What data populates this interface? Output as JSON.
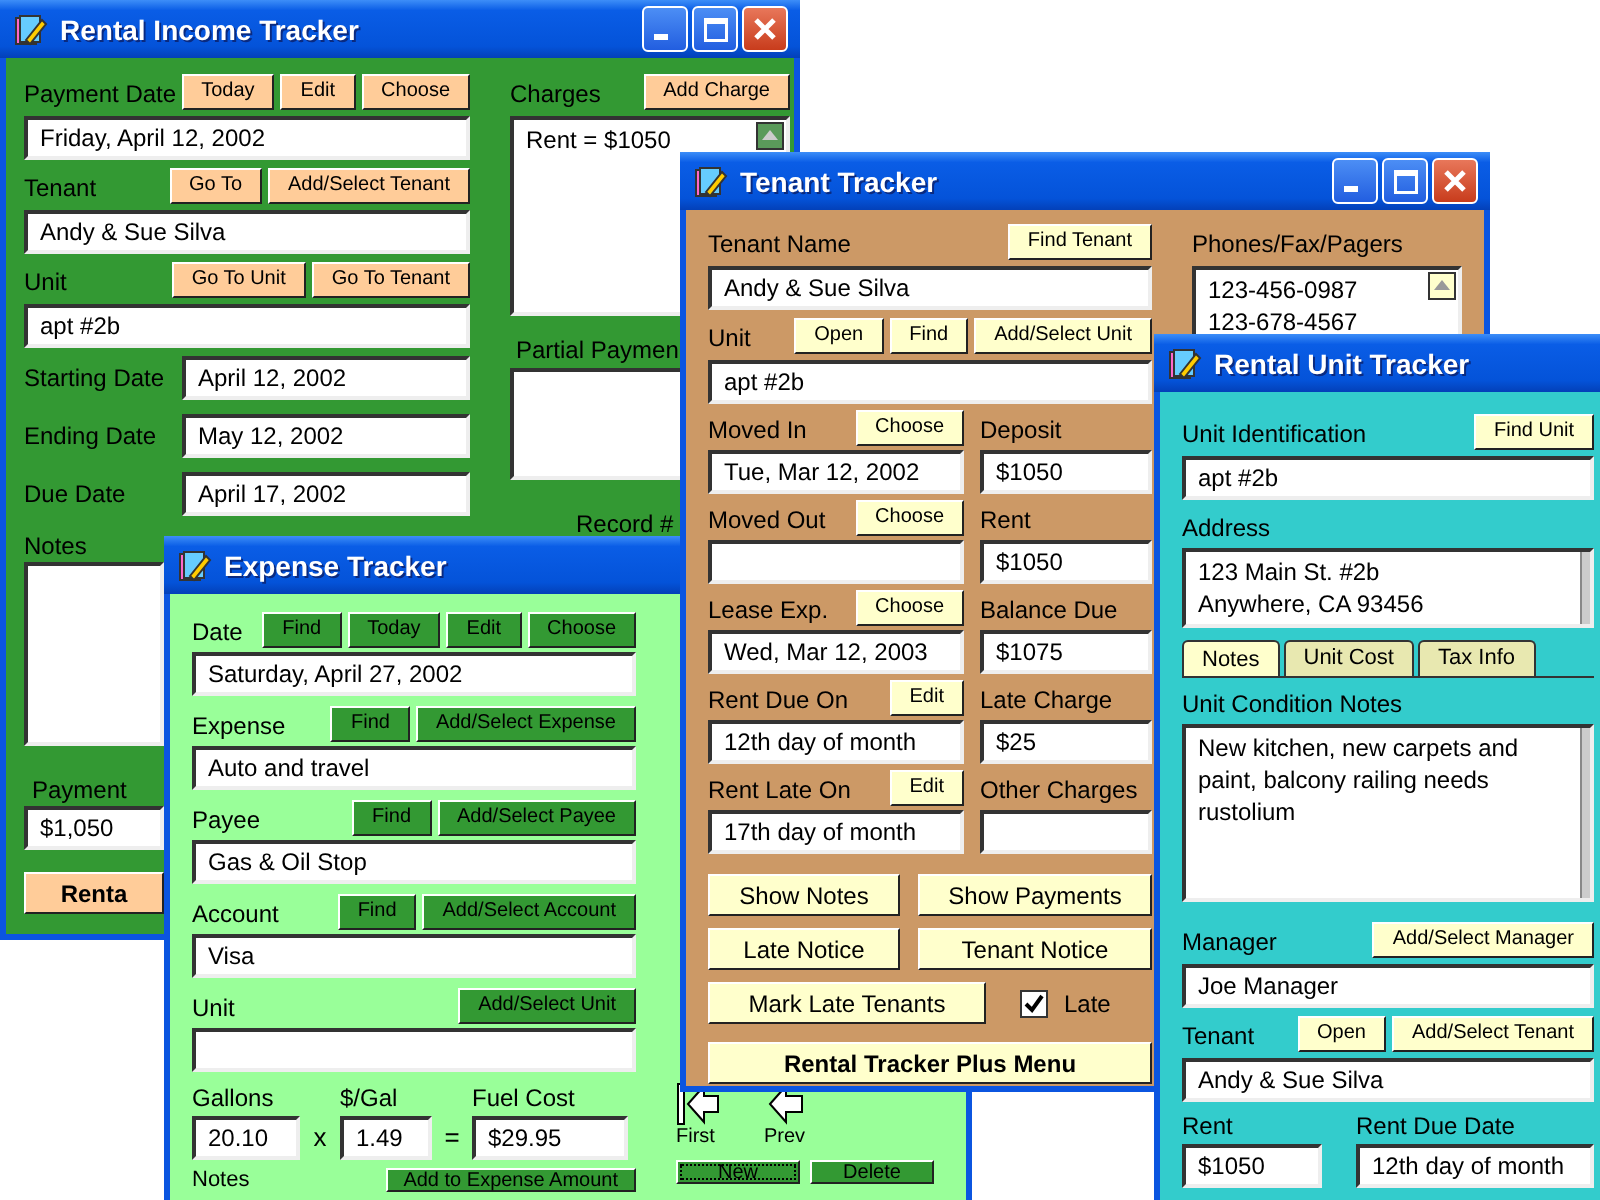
{
  "rental_income_tracker": {
    "title": "Rental Income Tracker",
    "fields": [
      {
        "label": "Payment Date",
        "buttons": [
          "Today",
          "Edit",
          "Choose"
        ],
        "value": "Friday, April 12, 2002"
      },
      {
        "label": "Tenant",
        "buttons": [
          "Go To",
          "Add/Select Tenant"
        ],
        "value": "Andy & Sue Silva"
      },
      {
        "label": "Unit",
        "buttons": [
          "Go To Unit",
          "Go To Tenant"
        ],
        "value": "apt #2b"
      }
    ],
    "dates": [
      {
        "label": "Starting Date",
        "value": "April 12, 2002"
      },
      {
        "label": "Ending Date",
        "value": "May 12, 2002"
      },
      {
        "label": "Due Date",
        "value": "April 17, 2002"
      }
    ],
    "notes": {
      "label": "Notes"
    },
    "payment": {
      "label": "Payment",
      "value": "$1,050"
    },
    "menu_button": "Renta",
    "charges": {
      "label": "Charges",
      "button": "Add Charge",
      "items": [
        "Rent = $1050"
      ]
    },
    "partial_payments": {
      "label": "Partial Paymen"
    },
    "record": {
      "label": "Record #"
    }
  },
  "expense_tracker": {
    "title": "Expense Tracker",
    "fields": [
      {
        "label": "Date",
        "buttons": [
          "Find",
          "Today",
          "Edit",
          "Choose"
        ],
        "value": "Saturday, April 27, 2002"
      },
      {
        "label": "Expense",
        "buttons": [
          "Find",
          "Add/Select Expense"
        ],
        "value": "Auto and travel"
      },
      {
        "label": "Payee",
        "buttons": [
          "Find",
          "Add/Select Payee"
        ],
        "value": "Gas & Oil Stop"
      },
      {
        "label": "Account",
        "buttons": [
          "Find",
          "Add/Select Account"
        ],
        "value": "Visa"
      },
      {
        "label": "Unit",
        "buttons": [
          "Add/Select Unit"
        ]
      }
    ],
    "fuel": {
      "gallons": {
        "label": "Gallons",
        "value": "20.10"
      },
      "times": "x",
      "price": {
        "label": "$/Gal",
        "value": "1.49"
      },
      "equals": "=",
      "cost": {
        "label": "Fuel Cost",
        "value": "$29.95"
      }
    },
    "notes": {
      "label": "Notes",
      "button": "Add to Expense Amount"
    },
    "nav": [
      {
        "kind": "first",
        "label": "First"
      },
      {
        "kind": "prev",
        "label": "Prev"
      }
    ],
    "buttons": [
      {
        "label": "New",
        "focused": true
      },
      {
        "label": "Delete",
        "focused": false
      }
    ]
  },
  "tenant_tracker": {
    "title": "Tenant Tracker",
    "fields": [
      {
        "label": "Tenant Name",
        "buttons": [
          "Find Tenant"
        ],
        "value": "Andy & Sue Silva"
      },
      {
        "label": "Unit",
        "buttons": [
          "Open",
          "Find",
          "Add/Select Unit"
        ],
        "value": "apt #2b"
      }
    ],
    "phones": {
      "label": "Phones/Fax/Pagers",
      "items": [
        "123-456-0987",
        "123-678-4567"
      ]
    },
    "rows": [
      {
        "left": {
          "label": "Moved In",
          "buttons": [
            "Choose"
          ],
          "value": "Tue, Mar 12, 2002"
        },
        "right": {
          "label": "Deposit",
          "value": "$1050"
        }
      },
      {
        "left": {
          "label": "Moved Out",
          "buttons": [
            "Choose"
          ]
        },
        "right": {
          "label": "Rent",
          "value": "$1050"
        }
      },
      {
        "left": {
          "label": "Lease Exp.",
          "buttons": [
            "Choose"
          ],
          "value": "Wed, Mar 12, 2003"
        },
        "right": {
          "label": "Balance Due",
          "value": "$1075"
        }
      },
      {
        "left": {
          "label": "Rent Due On",
          "buttons": [
            "Edit"
          ],
          "value": "12th day of month"
        },
        "right": {
          "label": "Late Charge",
          "value": "$25"
        }
      },
      {
        "left": {
          "label": "Rent Late On",
          "buttons": [
            "Edit"
          ],
          "value": "17th day of month"
        },
        "right": {
          "label": "Other Charges"
        }
      }
    ],
    "actions": [
      [
        "Show Notes",
        "Show Payments"
      ],
      [
        "Late Notice",
        "Tenant Notice"
      ]
    ],
    "mark_button": "Mark Late Tenants",
    "late": {
      "label": "Late",
      "checked": true
    },
    "menu_button": "Rental Tracker Plus Menu"
  },
  "rental_unit_tracker": {
    "title": "Rental Unit Tracker",
    "unit": {
      "label": "Unit Identification",
      "buttons": [
        "Find Unit"
      ],
      "value": "apt #2b"
    },
    "address": {
      "label": "Address",
      "lines": [
        "123 Main St. #2b",
        "Anywhere, CA 93456"
      ]
    },
    "tabs": [
      {
        "label": "Notes",
        "selected": true
      },
      {
        "label": "Unit Cost",
        "selected": false
      },
      {
        "label": "Tax Info",
        "selected": false
      }
    ],
    "notes": {
      "label": "Unit Condition Notes",
      "value": "New kitchen, new carpets and paint, balcony railing needs rustolium"
    },
    "manager": {
      "label": "Manager",
      "buttons": [
        "Add/Select Manager"
      ],
      "value": "Joe Manager"
    },
    "tenant": {
      "label": "Tenant",
      "buttons": [
        "Open",
        "Add/Select Tenant"
      ],
      "value": "Andy & Sue Silva"
    },
    "rent": {
      "label": "Rent",
      "value": "$1050"
    },
    "rent_due": {
      "label": "Rent Due Date",
      "value": "12th day of month"
    }
  }
}
